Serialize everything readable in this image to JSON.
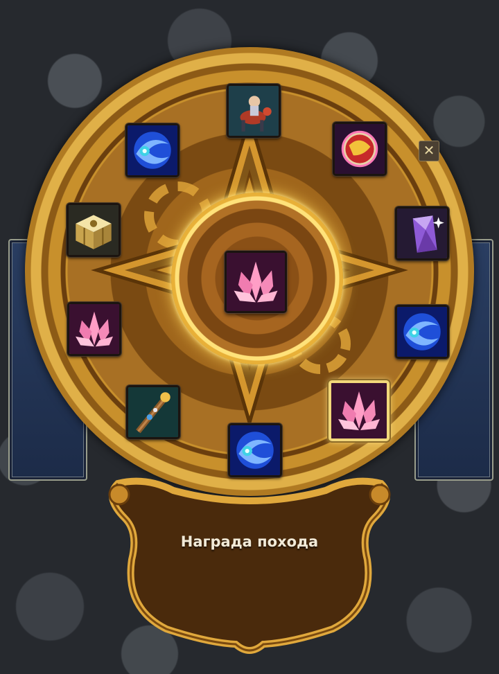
{
  "banner": {
    "title": "Награда похода"
  },
  "close_button": {
    "glyph": "✕"
  },
  "center_reward": {
    "icon": "pink-crystal-icon"
  },
  "rewards": [
    {
      "id": "top",
      "icon": "hero-on-mount-icon",
      "selected": false
    },
    {
      "id": "top-right",
      "icon": "red-yellow-orb-icon",
      "selected": false
    },
    {
      "id": "right-upper",
      "icon": "purple-gem-icon",
      "selected": false
    },
    {
      "id": "right-lower",
      "icon": "blue-swirl-icon",
      "selected": false
    },
    {
      "id": "bottom-right",
      "icon": "pink-crystal-icon",
      "selected": true
    },
    {
      "id": "bottom",
      "icon": "blue-swirl-icon",
      "selected": false
    },
    {
      "id": "bottom-left",
      "icon": "staff-weapon-icon",
      "selected": false
    },
    {
      "id": "left-lower",
      "icon": "pink-crystal-icon",
      "selected": false
    },
    {
      "id": "left-upper",
      "icon": "golden-chest-icon",
      "selected": false
    },
    {
      "id": "top-left",
      "icon": "blue-swirl-icon",
      "selected": false
    }
  ],
  "colors": {
    "gold": "#c8902c",
    "gold_highlight": "#ffe27a",
    "panel_blue": "#1c2b48",
    "banner_brown": "#4a2a0c",
    "title_text": "#f2ead8"
  }
}
